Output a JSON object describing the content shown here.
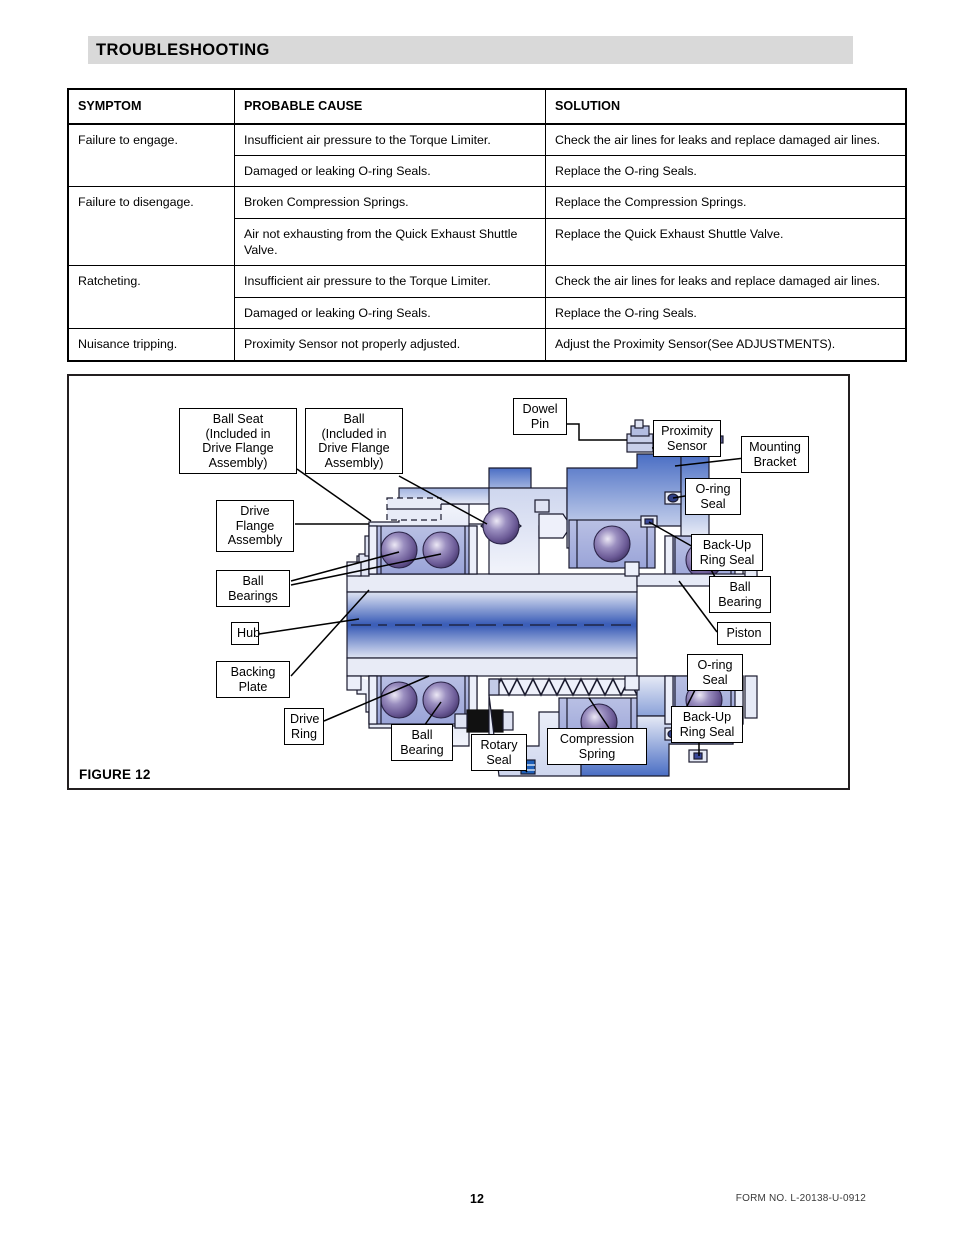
{
  "header": {
    "title": "TROUBLESHOOTING",
    "band_color": "#d9d9d9"
  },
  "table": {
    "columns": [
      "SYMPTOM",
      "PROBABLE CAUSE",
      "SOLUTION"
    ],
    "rows": [
      {
        "symptom": "Failure to engage.",
        "cause": "Insufficient air pressure to the Torque Limiter.",
        "solution": "Check the air lines for leaks and replace damaged air lines."
      },
      {
        "symptom": "",
        "cause": "Damaged or leaking O-ring Seals.",
        "solution": "Replace the O-ring Seals."
      },
      {
        "symptom": "Failure to disengage.",
        "cause": "Broken Compression Springs.",
        "solution": "Replace the Compression Springs."
      },
      {
        "symptom": "",
        "cause": "Air not exhausting from the Quick Exhaust Shuttle Valve.",
        "solution": "Replace the Quick Exhaust Shuttle Valve."
      },
      {
        "symptom": "Ratcheting.",
        "cause": "Insufficient air pressure to the Torque Limiter.",
        "solution": "Check the air lines for leaks and replace damaged air lines."
      },
      {
        "symptom": "",
        "cause": "Damaged or leaking O-ring Seals.",
        "solution": "Replace the O-ring Seals."
      },
      {
        "symptom": "Nuisance tripping.",
        "cause": "Proximity Sensor not properly adjusted.",
        "solution": "Adjust the Proximity Sensor(See ADJUSTMENTS)."
      }
    ]
  },
  "figure": {
    "caption": "FIGURE 12",
    "callouts": [
      {
        "id": "ball-seat",
        "lines": [
          "Ball Seat",
          "(Included in",
          "Drive Flange",
          "Assembly)"
        ]
      },
      {
        "id": "ball-included",
        "lines": [
          "Ball",
          "(Included in",
          "Drive Flange",
          "Assembly)"
        ]
      },
      {
        "id": "drive-flange",
        "lines": [
          "Drive",
          "Flange",
          "Assembly"
        ]
      },
      {
        "id": "ball-bearings",
        "lines": [
          "Ball",
          "Bearings"
        ]
      },
      {
        "id": "hub",
        "lines": [
          "Hub"
        ]
      },
      {
        "id": "backing-plate",
        "lines": [
          "Backing",
          "Plate"
        ]
      },
      {
        "id": "drive-ring",
        "lines": [
          "Drive",
          "Ring"
        ]
      },
      {
        "id": "ball-bearing-bot",
        "lines": [
          "Ball",
          "Bearing"
        ]
      },
      {
        "id": "rotary-seal",
        "lines": [
          "Rotary",
          "Seal"
        ]
      },
      {
        "id": "compression-spring",
        "lines": [
          "Compression",
          "Spring"
        ]
      },
      {
        "id": "dowel-pin",
        "lines": [
          "Dowel",
          "Pin"
        ]
      },
      {
        "id": "proximity-sensor",
        "lines": [
          "Proximity",
          "Sensor"
        ]
      },
      {
        "id": "mounting-bracket",
        "lines": [
          "Mounting",
          "Bracket"
        ]
      },
      {
        "id": "oring-seal-top",
        "lines": [
          "O-ring",
          "Seal"
        ]
      },
      {
        "id": "backup-ring-top",
        "lines": [
          "Back-Up",
          "Ring Seal"
        ]
      },
      {
        "id": "ball-bearing-rt",
        "lines": [
          "Ball",
          "Bearing"
        ]
      },
      {
        "id": "piston",
        "lines": [
          "Piston"
        ]
      },
      {
        "id": "oring-seal-bot",
        "lines": [
          "O-ring",
          "Seal"
        ]
      },
      {
        "id": "backup-ring-bot",
        "lines": [
          "Back-Up",
          "Ring Seal"
        ]
      }
    ],
    "colors": {
      "metal_light": "#e2e6f2",
      "metal_mid": "#aab4dd",
      "metal_dark": "#3d5fb8",
      "ball_dark": "#5a4a82",
      "ball_light": "#d8d0e8",
      "outline": "#1a1a2e"
    }
  },
  "footer": {
    "page_number": "12",
    "form_no": "FORM NO. L-20138-U-0912"
  }
}
